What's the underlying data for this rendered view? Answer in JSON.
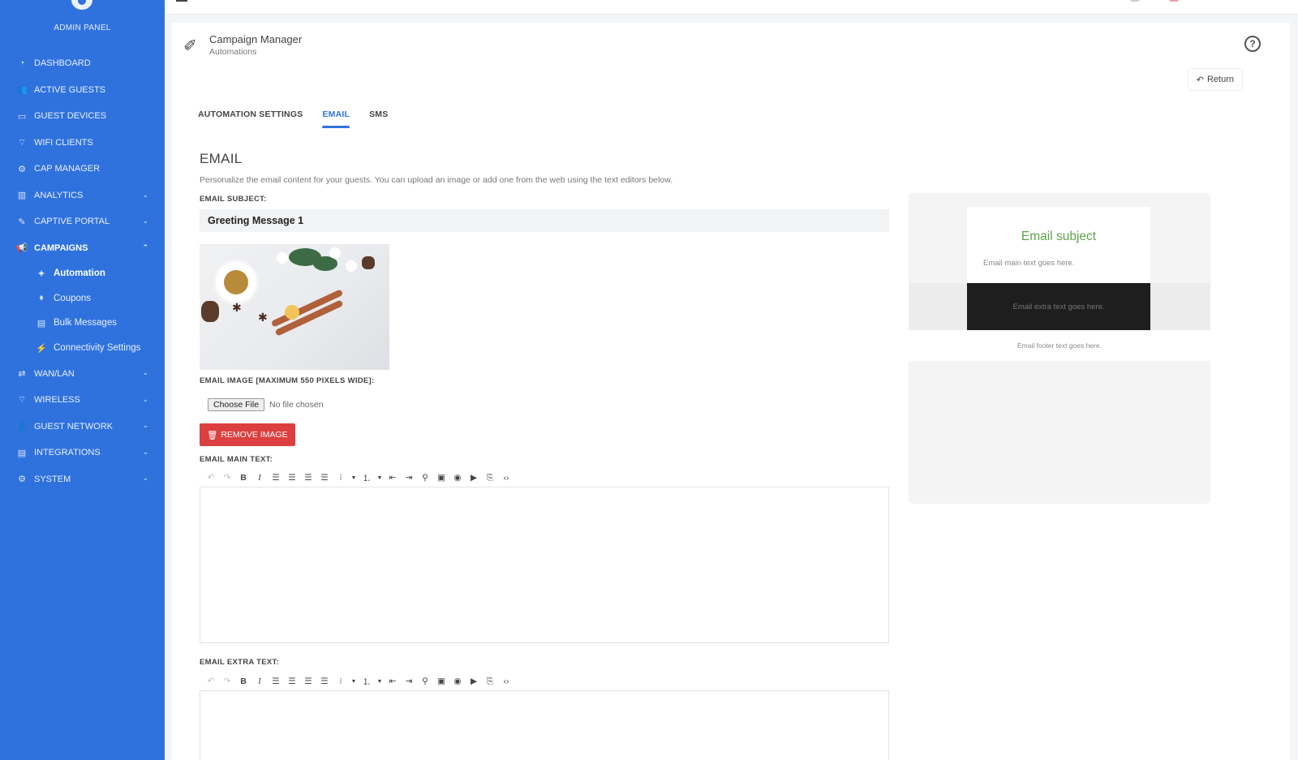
{
  "sidebar": {
    "admin_label": "ADMIN PANEL",
    "items": [
      {
        "label": "DASHBOARD",
        "icon": "dashboard-icon",
        "glyph": "◔"
      },
      {
        "label": "ACTIVE GUESTS",
        "icon": "users-icon",
        "glyph": "👥"
      },
      {
        "label": "GUEST DEVICES",
        "icon": "laptop-icon",
        "glyph": "▭"
      },
      {
        "label": "WIFI CLIENTS",
        "icon": "wifi-icon",
        "glyph": "⌔"
      },
      {
        "label": "CAP MANAGER",
        "icon": "gear-icon",
        "glyph": "⚙"
      },
      {
        "label": "ANALYTICS",
        "icon": "chart-icon",
        "glyph": "▥"
      },
      {
        "label": "CAPTIVE PORTAL",
        "icon": "edit-icon",
        "glyph": "✎"
      },
      {
        "label": "CAMPAIGNS",
        "icon": "megaphone-icon",
        "glyph": "📢"
      },
      {
        "label": "WAN/LAN",
        "icon": "exchange-icon",
        "glyph": "⇄"
      },
      {
        "label": "WIRELESS",
        "icon": "wifi-icon",
        "glyph": "⌔"
      },
      {
        "label": "GUEST NETWORK",
        "icon": "user-network-icon",
        "glyph": "👤"
      },
      {
        "label": "INTEGRATIONS",
        "icon": "server-icon",
        "glyph": "▤"
      },
      {
        "label": "SYSTEM",
        "icon": "gear-icon",
        "glyph": "⚙"
      }
    ],
    "sub_items": [
      {
        "label": "Automation",
        "icon": "magic-wand-icon",
        "glyph": "✦"
      },
      {
        "label": "Coupons",
        "icon": "tags-icon",
        "glyph": "⬧"
      },
      {
        "label": "Bulk Messages",
        "icon": "messages-icon",
        "glyph": "▤"
      },
      {
        "label": "Connectivity Settings",
        "icon": "plug-icon",
        "glyph": "⚡"
      }
    ]
  },
  "header": {
    "title": "Campaign Manager",
    "subtitle": "Automations",
    "return_label": "Return"
  },
  "tabs": [
    "AUTOMATION SETTINGS",
    "EMAIL",
    "SMS"
  ],
  "email": {
    "section_title": "EMAIL",
    "description": "Personalize the email content for your guests. You can upload an image or add one from the web using the text editors below.",
    "subject_label": "EMAIL SUBJECT:",
    "subject_value": "Greeting Message 1",
    "image_label": "EMAIL IMAGE [MAXIMUM 550 PIXELS WIDE]:",
    "choose_file_label": "Choose File",
    "no_file_label": "No file chosen",
    "remove_image_label": "REMOVE IMAGE",
    "main_text_label": "EMAIL MAIN TEXT:",
    "extra_text_label": "EMAIL EXTRA TEXT:"
  },
  "preview": {
    "subject": "Email subject",
    "main_text": "Email main text goes here.",
    "extra_text": "Email extra text goes here.",
    "footer_text": "Email footer text goes here."
  },
  "colors": {
    "sidebar": "#2f72de",
    "accent": "#2f72de",
    "danger": "#dc3f3f",
    "preview_subject": "#5fa248"
  }
}
